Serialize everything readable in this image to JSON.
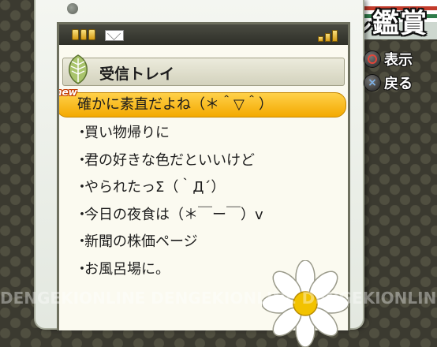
{
  "screen_title": "メール鑑賞",
  "inbox": {
    "title": "受信トレイ"
  },
  "messages": [
    {
      "subject": "確かに素直だよね（＊＾▽＾）",
      "is_new": true,
      "badge": "new"
    },
    {
      "subject": "買い物帰りに",
      "is_new": false
    },
    {
      "subject": "君の好きな色だといいけど",
      "is_new": false
    },
    {
      "subject": "やられたっΣ（｀Д´）",
      "is_new": false
    },
    {
      "subject": "今日の夜食は（＊￣ー￣）v",
      "is_new": false
    },
    {
      "subject": "新聞の株価ページ",
      "is_new": false
    },
    {
      "subject": "お風呂場に。",
      "is_new": false
    }
  ],
  "buttons": {
    "view_label": "表示",
    "back_label": "戻る"
  },
  "watermark": "DENGEKIONLINE DENGEKIONLINE DENGEKIONLINE DENGEKIONLINE",
  "icons": {
    "battery": "battery-icon",
    "mail": "mail-icon",
    "signal": "signal-icon",
    "leaf": "leaf-icon",
    "circle_button": "circle-button-icon",
    "cross_button": "cross-button-icon"
  },
  "colors": {
    "selection": "#f3a900",
    "stripe_red": "#c23a2a",
    "stripe_green": "#2f7c4a"
  }
}
